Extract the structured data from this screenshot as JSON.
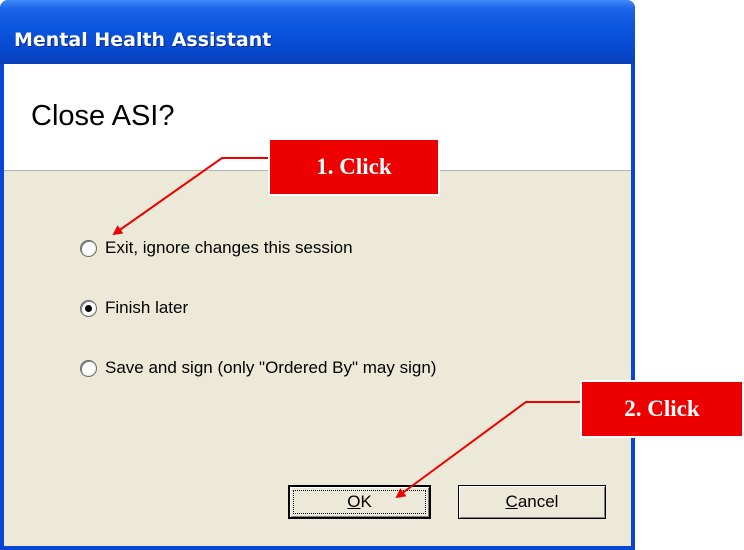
{
  "window": {
    "title": "Mental Health Assistant"
  },
  "dialog": {
    "heading": "Close ASI?",
    "options": [
      {
        "label": "Exit, ignore changes this session",
        "selected": false
      },
      {
        "label": "Finish later",
        "selected": true
      },
      {
        "label": "Save and sign (only \"Ordered By\" may sign)",
        "selected": false
      }
    ],
    "buttons": {
      "ok": "OK",
      "cancel": "Cancel"
    }
  },
  "annotations": {
    "step1": "1. Click",
    "step2": "2. Click"
  },
  "colors": {
    "titlebar": "#0a55dd",
    "dialog_bg": "#ece9d8",
    "callout": "#ee0000"
  }
}
